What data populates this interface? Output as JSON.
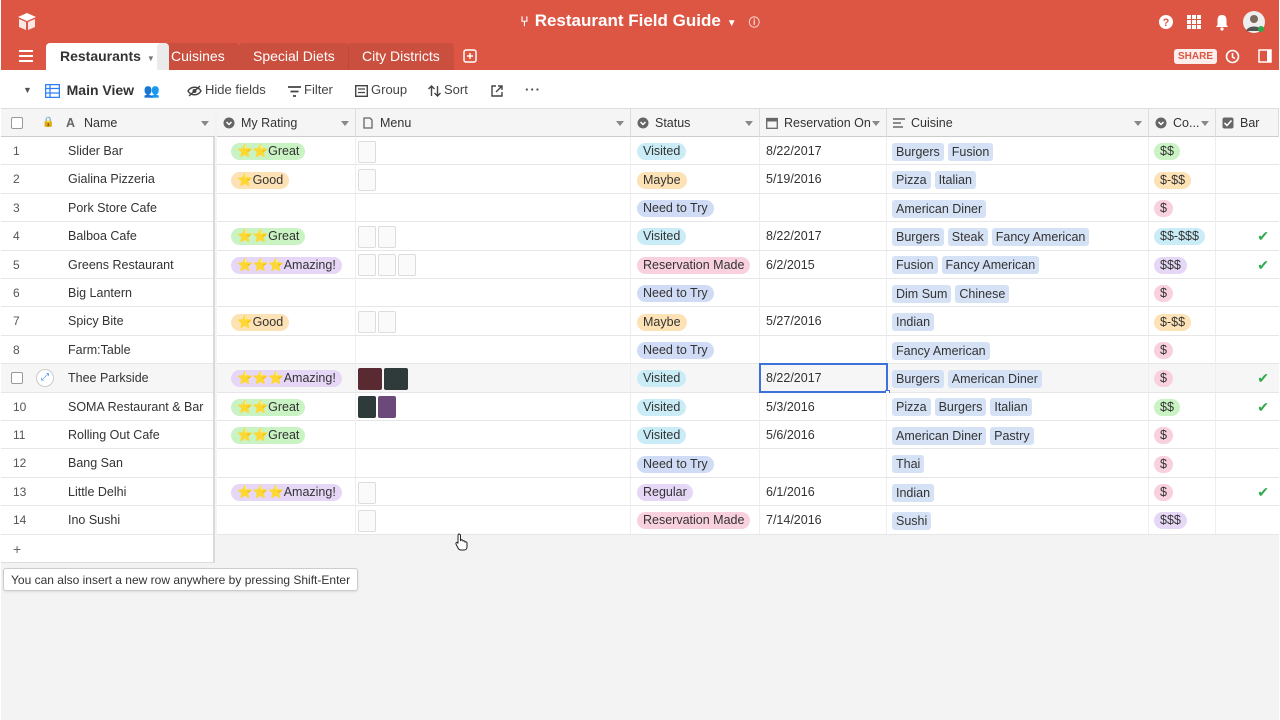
{
  "app": {
    "title": "Restaurant Field Guide",
    "brand_color": "#dd5644",
    "share_label": "SHARE"
  },
  "tabs": [
    "Restaurants",
    "Cuisines",
    "Special Diets",
    "City Districts"
  ],
  "toolbar": {
    "view_name": "Main View",
    "hide_fields": "Hide fields",
    "filter": "Filter",
    "group": "Group",
    "sort": "Sort"
  },
  "columns": {
    "name": "Name",
    "rating": "My Rating",
    "menu": "Menu",
    "status": "Status",
    "reservation": "Reservation On",
    "cuisine": "Cuisine",
    "cost": "Co...",
    "bar": "Bar"
  },
  "rows": [
    {
      "num": "1",
      "name": "Slider Bar",
      "rating": "⭐⭐Great",
      "rating_color": "#c9f3c2",
      "menu": [
        "doc"
      ],
      "status": "Visited",
      "status_color": "#c9ecf7",
      "date": "8/22/2017",
      "cuisine": [
        "Burgers",
        "Fusion"
      ],
      "cost": "$$",
      "cost_color": "#c9f3c2",
      "bar": false
    },
    {
      "num": "2",
      "name": "Gialina Pizzeria",
      "rating": "⭐Good",
      "rating_color": "#fde2b6",
      "menu": [
        "doc"
      ],
      "status": "Maybe",
      "status_color": "#fde2b6",
      "date": "5/19/2016",
      "cuisine": [
        "Pizza",
        "Italian"
      ],
      "cost": "$-$$",
      "cost_color": "#fde2b6",
      "bar": false
    },
    {
      "num": "3",
      "name": "Pork Store Cafe",
      "rating": "",
      "rating_color": "",
      "menu": [],
      "status": "Need to Try",
      "status_color": "#d0dcf5",
      "date": "",
      "cuisine": [
        "American Diner"
      ],
      "cost": "$",
      "cost_color": "#f9d0dd",
      "bar": false
    },
    {
      "num": "4",
      "name": "Balboa Cafe",
      "rating": "⭐⭐Great",
      "rating_color": "#c9f3c2",
      "menu": [
        "doc",
        "doc"
      ],
      "status": "Visited",
      "status_color": "#c9ecf7",
      "date": "8/22/2017",
      "cuisine": [
        "Burgers",
        "Steak",
        "Fancy American"
      ],
      "cost": "$$-$$$",
      "cost_color": "#c9ecf7",
      "bar": true
    },
    {
      "num": "5",
      "name": "Greens Restaurant",
      "rating": "⭐⭐⭐Amazing!",
      "rating_color": "#e7d7f7",
      "menu": [
        "doc",
        "doc",
        "doc"
      ],
      "status": "Reservation Made",
      "status_color": "#f9d0dd",
      "date": "6/2/2015",
      "cuisine": [
        "Fusion",
        "Fancy American"
      ],
      "cost": "$$$",
      "cost_color": "#e7d7f7",
      "bar": true
    },
    {
      "num": "6",
      "name": "Big Lantern",
      "rating": "",
      "rating_color": "",
      "menu": [],
      "status": "Need to Try",
      "status_color": "#d0dcf5",
      "date": "",
      "cuisine": [
        "Dim Sum",
        "Chinese"
      ],
      "cost": "$",
      "cost_color": "#f9d0dd",
      "bar": false
    },
    {
      "num": "7",
      "name": "Spicy Bite",
      "rating": "⭐Good",
      "rating_color": "#fde2b6",
      "menu": [
        "doc",
        "doc"
      ],
      "status": "Maybe",
      "status_color": "#fde2b6",
      "date": "5/27/2016",
      "cuisine": [
        "Indian"
      ],
      "cost": "$-$$",
      "cost_color": "#fde2b6",
      "bar": false
    },
    {
      "num": "8",
      "name": "Farm:Table",
      "rating": "",
      "rating_color": "",
      "menu": [],
      "status": "Need to Try",
      "status_color": "#d0dcf5",
      "date": "",
      "cuisine": [
        "Fancy American"
      ],
      "cost": "$",
      "cost_color": "#f9d0dd",
      "bar": false
    },
    {
      "num": "",
      "name": "Thee Parkside",
      "rating": "⭐⭐⭐Amazing!",
      "rating_color": "#e7d7f7",
      "menu": [
        "photo",
        "photo"
      ],
      "status": "Visited",
      "status_color": "#c9ecf7",
      "date": "8/22/2017",
      "cuisine": [
        "Burgers",
        "American Diner"
      ],
      "cost": "$",
      "cost_color": "#f9d0dd",
      "bar": true
    },
    {
      "num": "10",
      "name": "SOMA Restaurant & Bar",
      "rating": "⭐⭐Great",
      "rating_color": "#c9f3c2",
      "menu": [
        "photo",
        "photo"
      ],
      "status": "Visited",
      "status_color": "#c9ecf7",
      "date": "5/3/2016",
      "cuisine": [
        "Pizza",
        "Burgers",
        "Italian"
      ],
      "cost": "$$",
      "cost_color": "#c9f3c2",
      "bar": true
    },
    {
      "num": "11",
      "name": "Rolling Out Cafe",
      "rating": "⭐⭐Great",
      "rating_color": "#c9f3c2",
      "menu": [],
      "status": "Visited",
      "status_color": "#c9ecf7",
      "date": "5/6/2016",
      "cuisine": [
        "American Diner",
        "Pastry"
      ],
      "cost": "$",
      "cost_color": "#f9d0dd",
      "bar": false
    },
    {
      "num": "12",
      "name": "Bang San",
      "rating": "",
      "rating_color": "",
      "menu": [],
      "status": "Need to Try",
      "status_color": "#d0dcf5",
      "date": "",
      "cuisine": [
        "Thai"
      ],
      "cost": "$",
      "cost_color": "#f9d0dd",
      "bar": false
    },
    {
      "num": "13",
      "name": "Little Delhi",
      "rating": "⭐⭐⭐Amazing!",
      "rating_color": "#e7d7f7",
      "menu": [
        "doc"
      ],
      "status": "Regular",
      "status_color": "#e7d7f7",
      "date": "6/1/2016",
      "cuisine": [
        "Indian"
      ],
      "cost": "$",
      "cost_color": "#f9d0dd",
      "bar": true
    },
    {
      "num": "14",
      "name": "Ino Sushi",
      "rating": "",
      "rating_color": "",
      "menu": [
        "doc"
      ],
      "status": "Reservation Made",
      "status_color": "#f9d0dd",
      "date": "7/14/2016",
      "cuisine": [
        "Sushi"
      ],
      "cost": "$$$",
      "cost_color": "#e7d7f7",
      "bar": false
    }
  ],
  "add_row_label": "+",
  "tooltip": "You can also insert a new row anywhere by pressing Shift-Enter"
}
